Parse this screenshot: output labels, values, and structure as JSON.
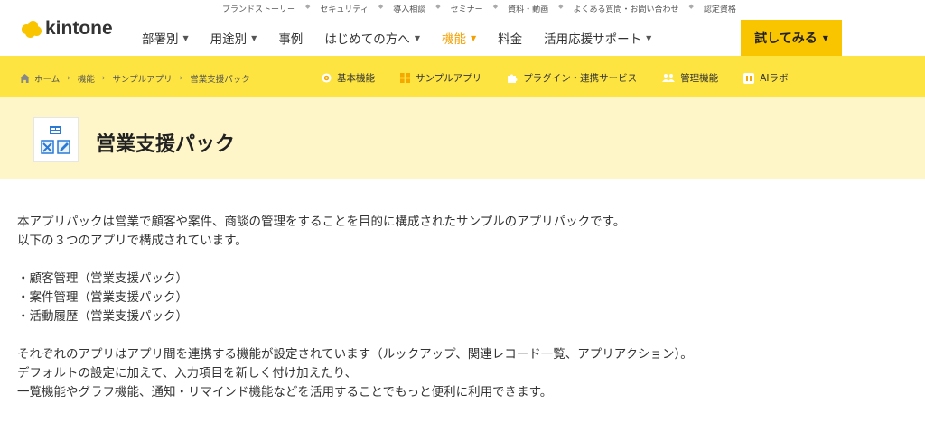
{
  "brand": {
    "name": "kintone",
    "color": "#f9c400"
  },
  "top_links": [
    "ブランドストーリー",
    "セキュリティ",
    "導入相談",
    "セミナー",
    "資料・動画",
    "よくある質問・お問い合わせ",
    "認定資格"
  ],
  "main_nav": [
    {
      "label": "部署別",
      "caret": true,
      "active": false
    },
    {
      "label": "用途別",
      "caret": true,
      "active": false
    },
    {
      "label": "事例",
      "caret": false,
      "active": false
    },
    {
      "label": "はじめての方へ",
      "caret": true,
      "active": false
    },
    {
      "label": "機能",
      "caret": true,
      "active": true
    },
    {
      "label": "料金",
      "caret": false,
      "active": false
    },
    {
      "label": "活用応援サポート",
      "caret": true,
      "active": false
    }
  ],
  "try_button": {
    "label": "試してみる"
  },
  "breadcrumb": [
    "ホーム",
    "機能",
    "サンプルアプリ",
    "営業支援パック"
  ],
  "sub_nav": [
    {
      "label": "基本機能",
      "icon": "gear-icon"
    },
    {
      "label": "サンプルアプリ",
      "icon": "grid-icon"
    },
    {
      "label": "プラグイン・連携サービス",
      "icon": "puzzle-icon"
    },
    {
      "label": "管理機能",
      "icon": "users-icon"
    },
    {
      "label": "AIラボ",
      "icon": "ai-icon"
    }
  ],
  "page": {
    "title": "営業支援パック"
  },
  "content": {
    "intro": [
      "本アプリパックは営業で顧客や案件、商談の管理をすることを目的に構成されたサンプルのアプリパックです。",
      "以下の３つのアプリで構成されています。"
    ],
    "apps": [
      "・顧客管理（営業支援パック）",
      "・案件管理（営業支援パック）",
      "・活動履歴（営業支援パック）"
    ],
    "outro": [
      "それぞれのアプリはアプリ間を連携する機能が設定されています（ルックアップ、関連レコード一覧、アプリアクション）。",
      "デフォルトの設定に加えて、入力項目を新しく付け加えたり、",
      "一覧機能やグラフ機能、通知・リマインド機能などを活用することでもっと便利に利用できます。"
    ]
  }
}
